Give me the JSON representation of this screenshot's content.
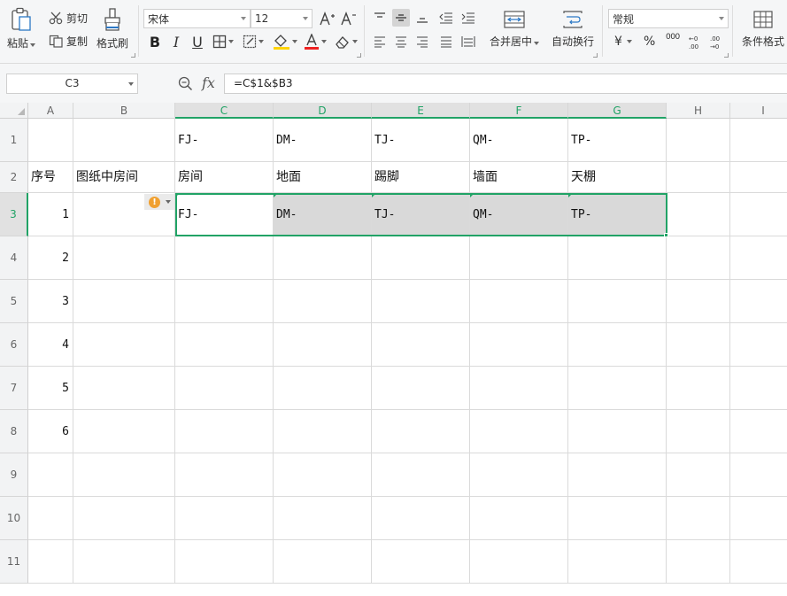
{
  "ribbon": {
    "paste": "粘贴",
    "cut": "剪切",
    "copy": "复制",
    "format_painter": "格式刷",
    "font_name": "宋体",
    "font_size": "12",
    "merge_center": "合并居中",
    "wrap_text": "自动换行",
    "number_format": "常规",
    "currency": "¥",
    "percent": "%",
    "thousands": "000",
    "conditional_format": "条件格式"
  },
  "formula_bar": {
    "name_box": "C3",
    "fx": "fx",
    "formula": "=C$1&$B3"
  },
  "columns": [
    "A",
    "B",
    "C",
    "D",
    "E",
    "F",
    "G",
    "H",
    "I"
  ],
  "rows": [
    "1",
    "2",
    "3",
    "4",
    "5",
    "6",
    "7",
    "8",
    "9",
    "10",
    "11"
  ],
  "cells": {
    "C1": "FJ-",
    "D1": "DM-",
    "E1": "TJ-",
    "F1": "QM-",
    "G1": "TP-",
    "A2": "序号",
    "B2": "图纸中房间",
    "C2": "房间",
    "D2": "地面",
    "E2": "踢脚",
    "F2": "墙面",
    "G2": "天棚",
    "A3": "1",
    "C3": "FJ-",
    "D3": "DM-",
    "E3": "TJ-",
    "F3": "QM-",
    "G3": "TP-",
    "A4": "2",
    "A5": "3",
    "A6": "4",
    "A7": "5",
    "A8": "6"
  },
  "selection": "C3:G3",
  "accent_color": "#21a366"
}
